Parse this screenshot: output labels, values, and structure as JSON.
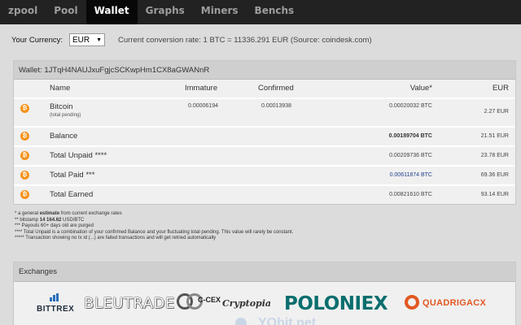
{
  "nav": {
    "items": [
      {
        "label": "zpool",
        "name": "nav-zpool",
        "active": false
      },
      {
        "label": "Pool",
        "name": "nav-pool",
        "active": false
      },
      {
        "label": "Wallet",
        "name": "nav-wallet",
        "active": true
      },
      {
        "label": "Graphs",
        "name": "nav-graphs",
        "active": false
      },
      {
        "label": "Miners",
        "name": "nav-miners",
        "active": false
      },
      {
        "label": "Benchs",
        "name": "nav-benchs",
        "active": false
      }
    ]
  },
  "currency": {
    "label": "Your Currency:",
    "selected": "EUR",
    "rate_text": "Current conversion rate: 1 BTC = 11336.291 EUR (Source: coindesk.com)"
  },
  "wallet": {
    "header": "Wallet: 1JTqH4NAUJxuFgjcSCKwpHm1CX8aGWANnR",
    "columns": {
      "name": "Name",
      "immature": "Immature",
      "confirmed": "Confirmed",
      "value": "Value*",
      "eur": "EUR"
    },
    "bitcoin": {
      "name": "Bitcoin",
      "sub": "(total pending)",
      "immature": "0.00006194",
      "confirmed": "0.00013938",
      "value": "0.00020032 BTC",
      "eur": "2.27 EUR"
    },
    "balance": {
      "label": "Balance",
      "value": "0.00189704 BTC",
      "eur": "21.51 EUR"
    },
    "unpaid": {
      "label": "Total Unpaid ****",
      "value": "0.00209736 BTC",
      "eur": "23.78 EUR"
    },
    "paid": {
      "label": "Total Paid ***",
      "value": "0.00611874 BTC",
      "eur": "69.36 EUR"
    },
    "earned": {
      "label": "Total Earned",
      "value": "0.00821610 BTC",
      "eur": "93.14 EUR"
    }
  },
  "notes": {
    "n1_pre": "* a general ",
    "n1_bold": "estimate",
    "n1_post": " from current exchange rates",
    "n2_pre": "** bitstamp ",
    "n2_bold": "14 164.62",
    "n2_post": " USD/BTC",
    "n3": "*** Payouts 60+ days old are purged",
    "n4": "**** Total Unpaid is a combination of your confirmed Balance and your fluctuating total pending. This value will rarely be constant.",
    "n5": "***** Transaction showing no tx id (...) are failed transactions and will get retried automatically"
  },
  "exchanges": {
    "header": "Exchanges",
    "logos": [
      "BITTREX",
      "BLEUTRADE",
      "C-CEX",
      "Cryptopia",
      "POLONIEX",
      "QUADRIGACX",
      "YObit.net"
    ]
  },
  "colors": {
    "navbar": "#222222",
    "bitcoin": "#f7931a",
    "poloniex": "#0a6e6e",
    "quadriga": "#e25822"
  }
}
